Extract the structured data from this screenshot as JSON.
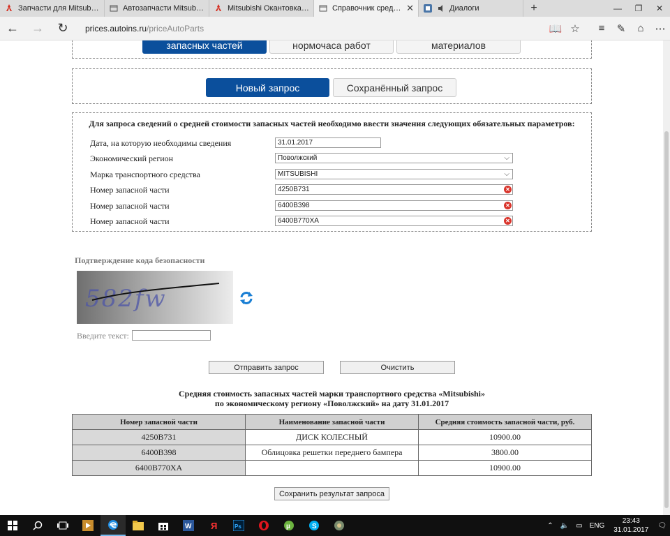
{
  "browser": {
    "tabs": [
      {
        "label": "Запчасти для Mitsubishi La",
        "active": false
      },
      {
        "label": "Автозапчасти Mitsubishi - .",
        "active": false
      },
      {
        "label": "Mitsubishi Окантовка реше",
        "active": false
      },
      {
        "label": "Справочник средней с",
        "active": true
      },
      {
        "label": "Диалоги",
        "active": false
      }
    ],
    "new_tab": "+",
    "url_domain": "prices.autoins.ru",
    "url_path": "/priceAutoParts"
  },
  "top_tabs": [
    "запасных частей",
    "нормочаса работ",
    "материалов"
  ],
  "mode_tabs": {
    "new": "Новый запрос",
    "saved": "Сохранённый запрос"
  },
  "form": {
    "title": "Для запроса сведений о средней стоимости запасных частей необходимо ввести значения следующих обязательных параметров:",
    "fields": [
      {
        "label": "Дата, на которую необходимы сведения",
        "value": "31.01.2017"
      },
      {
        "label": "Экономический регион",
        "value": "Поволжский"
      },
      {
        "label": "Марка транспортного средства",
        "value": "MITSUBISHI"
      },
      {
        "label": "Номер запасной части",
        "value": "4250B731"
      },
      {
        "label": "Номер запасной части",
        "value": "6400B398"
      },
      {
        "label": "Номер запасной части",
        "value": "6400B770XA"
      }
    ]
  },
  "captcha": {
    "title": "Подтверждение кода безопасности",
    "code": "582fw",
    "enter_label": "Введите текст:"
  },
  "buttons": {
    "submit": "Отправить запрос",
    "clear": "Очистить",
    "save": "Сохранить результат запроса"
  },
  "results": {
    "title_line1": "Средняя стоимость запасных частей марки транспортного средства «Mitsubishi»",
    "title_line2": "по экономическому региону «Поволжский» на дату 31.01.2017",
    "headers": [
      "Номер запасной части",
      "Наименование запасной части",
      "Средняя стоимость запасной части, руб."
    ],
    "rows": [
      {
        "number": "4250B731",
        "name": "ДИСК КОЛЕСНЫЙ",
        "price": "10900.00"
      },
      {
        "number": "6400B398",
        "name": "Облицовка решетки переднего бампера",
        "price": "3800.00"
      },
      {
        "number": "6400B770XA",
        "name": "",
        "price": "10900.00"
      }
    ]
  },
  "taskbar": {
    "lang": "ENG",
    "time": "23:43",
    "date": "31.01.2017"
  },
  "colors": {
    "accent": "#0b4f9c",
    "table_header": "#d0d0d0",
    "taskbar": "#101010"
  }
}
